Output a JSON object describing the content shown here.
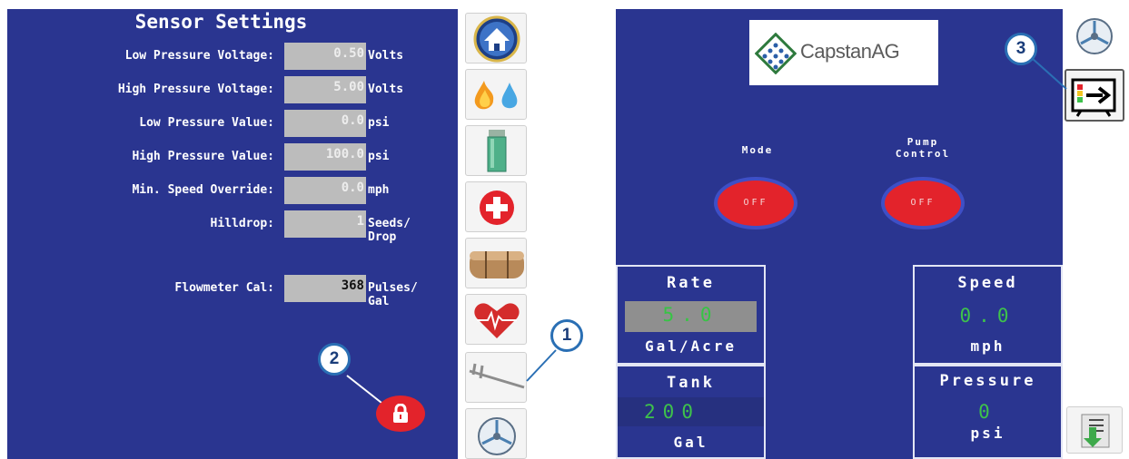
{
  "sensor_settings": {
    "title": "Sensor Settings",
    "rows": [
      {
        "label": "Low Pressure Voltage:",
        "value": "0.50",
        "unit": "Volts"
      },
      {
        "label": "High Pressure Voltage:",
        "value": "5.00",
        "unit": "Volts"
      },
      {
        "label": "Low Pressure Value:",
        "value": "0.0",
        "unit": "psi"
      },
      {
        "label": "High Pressure Value:",
        "value": "100.0",
        "unit": "psi"
      },
      {
        "label": "Min. Speed Override:",
        "value": "0.0",
        "unit": "mph"
      },
      {
        "label": "Hilldrop:",
        "value": "1",
        "unit_line1": "Seeds/",
        "unit_line2": "Drop"
      },
      {
        "label": "Flowmeter Cal:",
        "value": "368",
        "unit_line1": "Pulses/",
        "unit_line2": "Gal"
      }
    ]
  },
  "icon_strip": [
    "home-icon",
    "fire-water-icon",
    "jar-icon",
    "medical-cross-icon",
    "tank-icon",
    "heart-rate-icon",
    "caliper-icon",
    "fan-icon"
  ],
  "main": {
    "logo": "CapstanAG",
    "mode": {
      "label": "Mode",
      "state": "OFF"
    },
    "pump_control": {
      "label_line1": "Pump",
      "label_line2": "Control",
      "state": "OFF"
    },
    "rate": {
      "title": "Rate",
      "value": "5.0",
      "unit": "Gal/Acre"
    },
    "tank": {
      "title": "Tank",
      "value": "200",
      "unit": "Gal"
    },
    "speed": {
      "title": "Speed",
      "value": "0.0",
      "unit": "mph"
    },
    "pressure": {
      "title": "Pressure",
      "value": "0",
      "unit": "psi"
    }
  },
  "right_strip": [
    "fan-icon",
    "exit-icon",
    "download-icon"
  ],
  "callouts": [
    "1",
    "2",
    "3"
  ],
  "colors": {
    "screen_bg": "#2a3590",
    "value_green": "#3ec24b",
    "button_red": "#e3232b",
    "callout_border": "#2a6fb4"
  }
}
